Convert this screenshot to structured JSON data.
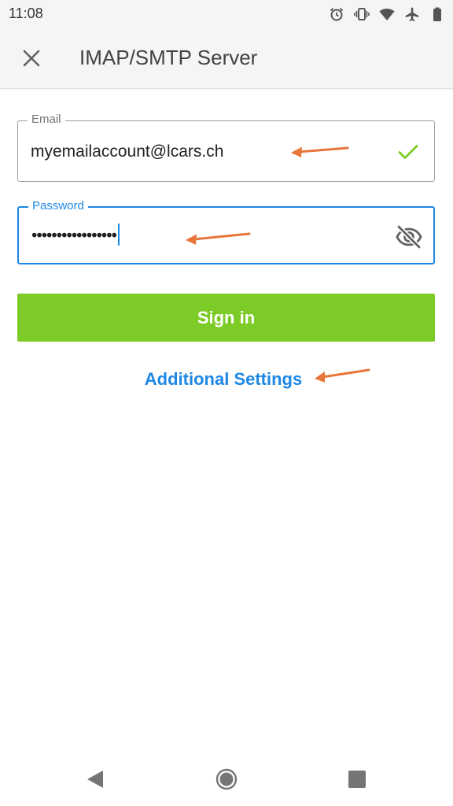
{
  "status_bar": {
    "time": "11:08",
    "icons": [
      "alarm-icon",
      "vibrate-icon",
      "wifi-icon",
      "airplane-icon",
      "battery-icon"
    ]
  },
  "app_bar": {
    "close_icon": "close-icon",
    "title": "IMAP/SMTP Server"
  },
  "form": {
    "email": {
      "label": "Email",
      "value": "myemailaccount@lcars.ch",
      "status_icon": "check-icon"
    },
    "password": {
      "label": "Password",
      "value": "•••••••••••••••••",
      "toggle_icon": "eye-off-icon"
    },
    "sign_in_label": "Sign in",
    "additional_settings_label": "Additional Settings"
  },
  "nav_bar": {
    "icons": [
      "back-icon",
      "home-icon",
      "recents-icon"
    ]
  },
  "colors": {
    "accent": "#1e88e5",
    "button": "#7ccb26",
    "check": "#7ccb26",
    "annotation_arrow": "#e8763a"
  }
}
